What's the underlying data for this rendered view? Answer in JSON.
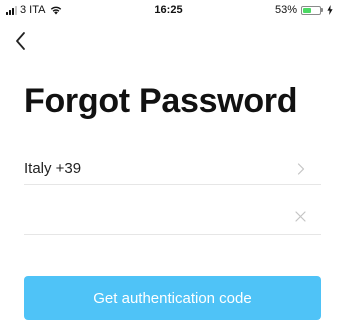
{
  "status_bar": {
    "carrier": "3 ITA",
    "time": "16:25",
    "battery_percent_text": "53%",
    "battery_level": 0.53
  },
  "nav": {
    "back_icon": "chevron-left-icon"
  },
  "page": {
    "title": "Forgot Password"
  },
  "form": {
    "country": {
      "label": "Italy +39",
      "icon": "chevron-right-icon"
    },
    "phone": {
      "value": "",
      "placeholder": "",
      "clear_icon": "close-icon"
    },
    "submit_label": "Get authentication code"
  },
  "colors": {
    "accent": "#4fc3f7",
    "battery": "#4cd964",
    "divider": "#e6e6e6"
  }
}
